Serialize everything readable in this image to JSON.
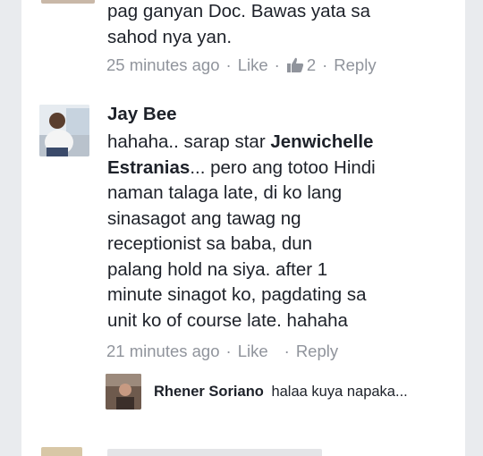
{
  "top_comment": {
    "avatar_icon": "user-avatar-icon",
    "text_lines": [
      "pag ganyan Doc. Bawas yata sa",
      "sahod nya yan."
    ],
    "time": "25 minutes ago",
    "like_label": "Like",
    "reaction_count": "2",
    "reply_label": "Reply"
  },
  "comment": {
    "name": "Jay Bee",
    "line1_pre": "hahaha.. sarap star ",
    "tag_first": "Jenwichelle",
    "tag_last": "Estranias",
    "line2_post": "... pero ang totoo Hindi",
    "lines": [
      "naman talaga late, di ko lang",
      "sinasagot ang tawag ng",
      "receptionist sa baba, dun",
      "palang hold na siya. after 1",
      "minute sinagot ko, pagdating sa",
      "unit ko of course late. hahaha"
    ],
    "time": "21 minutes ago",
    "like_label": "Like",
    "reply_label": "Reply"
  },
  "reply": {
    "name": "Rhener Soriano",
    "text": "halaa kuya napaka..."
  },
  "colors": {
    "page_bg": "#e9ebee",
    "card_bg": "#ffffff",
    "text": "#1d2129",
    "meta": "#90949c"
  }
}
